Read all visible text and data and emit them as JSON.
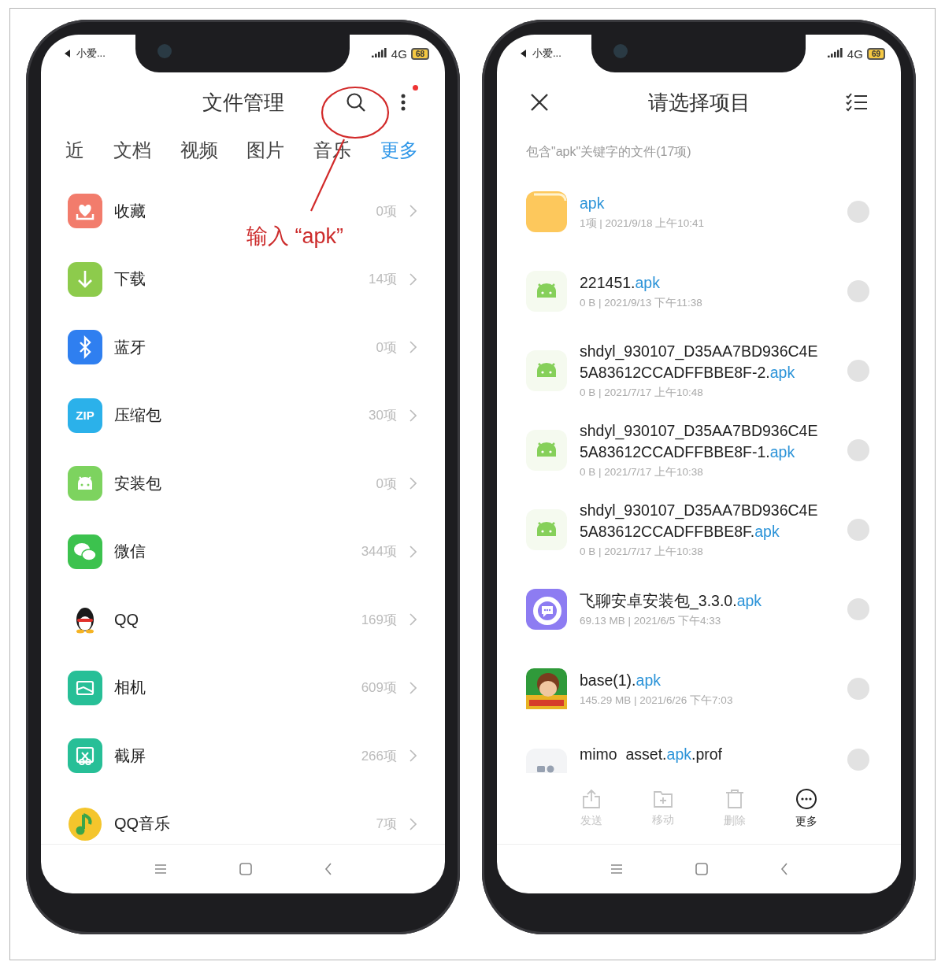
{
  "left_phone": {
    "status_bar": {
      "app": "小爱...",
      "network": "4G",
      "battery": "68"
    },
    "title": "文件管理",
    "annotation": {
      "text": "输入 “apk”"
    },
    "tabs": [
      {
        "label": "近",
        "selected": false
      },
      {
        "label": "文档",
        "selected": false
      },
      {
        "label": "视频",
        "selected": false
      },
      {
        "label": "图片",
        "selected": false
      },
      {
        "label": "音乐",
        "selected": false
      },
      {
        "label": "更多",
        "selected": true
      }
    ],
    "categories": [
      {
        "kind": "favorite",
        "label": "收藏",
        "count": "0项"
      },
      {
        "kind": "download",
        "label": "下载",
        "count": "14项"
      },
      {
        "kind": "bluetooth",
        "label": "蓝牙",
        "count": "0项"
      },
      {
        "kind": "zip",
        "icon_text": "ZIP",
        "label": "压缩包",
        "count": "30项"
      },
      {
        "kind": "package",
        "label": "安装包",
        "count": "0项"
      },
      {
        "kind": "chat",
        "label": "微信",
        "count": "344项"
      },
      {
        "kind": "penguin",
        "label": "QQ",
        "count": "169项"
      },
      {
        "kind": "camera",
        "label": "相机",
        "count": "609项"
      },
      {
        "kind": "screenshot",
        "label": "截屏",
        "count": "266项"
      },
      {
        "kind": "music",
        "label": "QQ音乐",
        "count": "7项"
      }
    ]
  },
  "right_phone": {
    "status_bar": {
      "app": "小爱...",
      "network": "4G",
      "battery": "69"
    },
    "title": "请选择项目",
    "summary": "包含\"apk\"关键字的文件(17项)",
    "files": [
      {
        "kind": "folder",
        "ext": "apk",
        "meta": "1项 | 2021/9/18 上午10:41",
        "selected": false
      },
      {
        "kind": "android",
        "name": "221451.",
        "ext": "apk",
        "meta": "0 B | 2021/9/13 下午11:38",
        "selected": false
      },
      {
        "kind": "android",
        "name": "shdyl_930107_D35AA7BD936C4E5A83612CCADFFBBE8F-2.",
        "ext": "apk",
        "meta": "0 B | 2021/7/17 上午10:48",
        "selected": false
      },
      {
        "kind": "android",
        "name": "shdyl_930107_D35AA7BD936C4E5A83612CCADFFBBE8F-1.",
        "ext": "apk",
        "meta": "0 B | 2021/7/17 上午10:38",
        "selected": false
      },
      {
        "kind": "android",
        "name": "shdyl_930107_D35AA7BD936C4E5A83612CCADFFBBE8F.",
        "ext": "apk",
        "meta": "0 B | 2021/7/17 上午10:38",
        "selected": false
      },
      {
        "kind": "chatapp",
        "name": "飞聊安卓安装包_3.3.0.",
        "ext": "apk",
        "meta": "69.13 MB | 2021/6/5 下午4:33",
        "selected": false
      },
      {
        "kind": "game",
        "name": "base(1).",
        "ext": "apk",
        "meta": "145.29 MB | 2021/6/26 下午7:03",
        "selected": false
      },
      {
        "kind": "generic",
        "name": "mimo  asset.",
        "ext": "apk",
        "suffix": ".prof",
        "selected": false
      }
    ],
    "actions": [
      {
        "kind": "send",
        "label": "发送",
        "disabled": true
      },
      {
        "kind": "move",
        "label": "移动",
        "disabled": true
      },
      {
        "kind": "delete",
        "label": "删除",
        "disabled": true
      },
      {
        "kind": "more",
        "label": "更多",
        "disabled": false
      }
    ]
  }
}
